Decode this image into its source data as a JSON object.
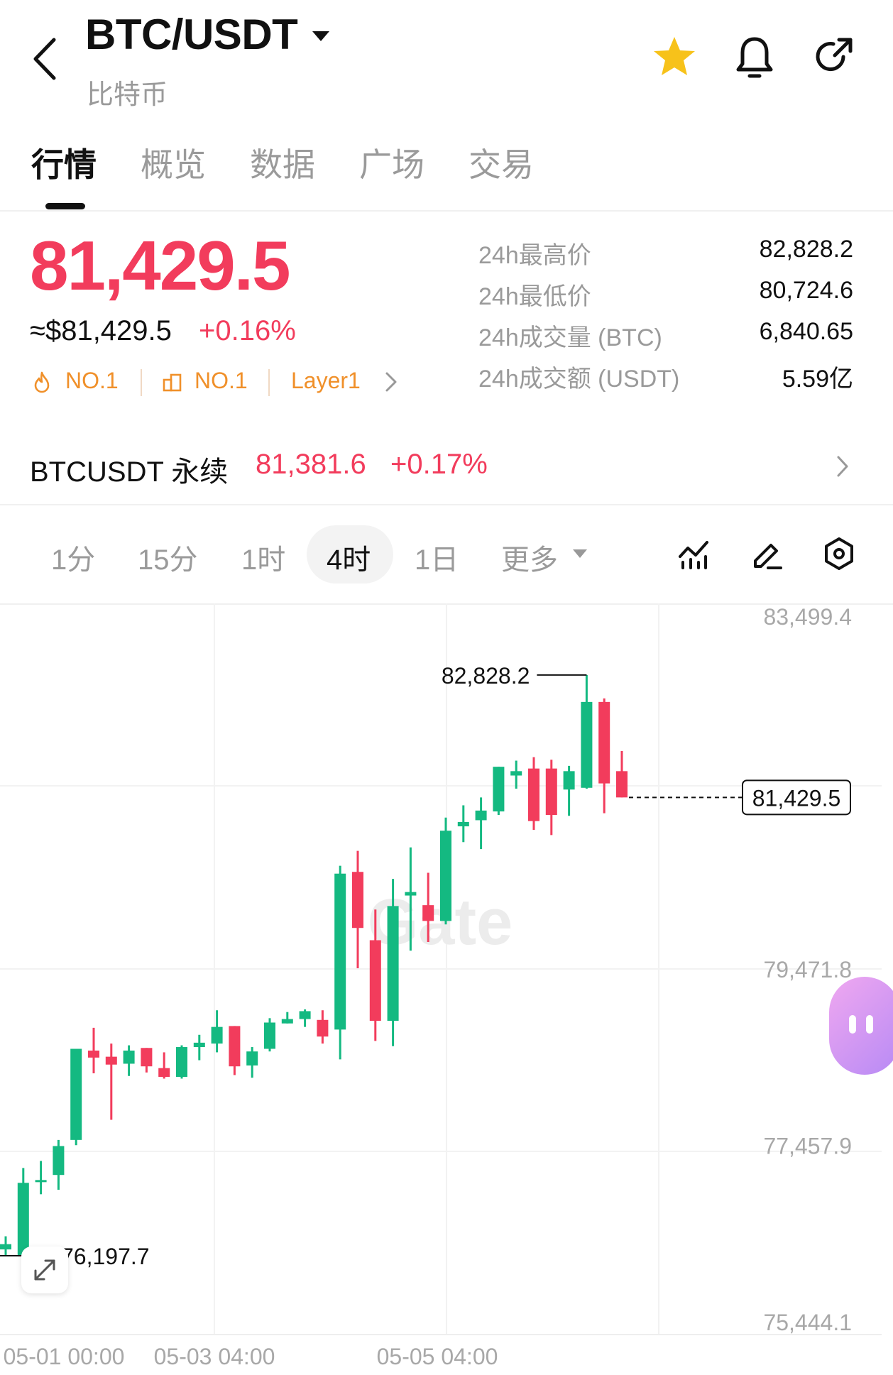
{
  "header": {
    "pair": "BTC/USDT",
    "subtitle": "比特币"
  },
  "tabs": [
    {
      "label": "行情",
      "active": true
    },
    {
      "label": "概览"
    },
    {
      "label": "数据"
    },
    {
      "label": "广场"
    },
    {
      "label": "交易"
    }
  ],
  "quote": {
    "price": "81,429.5",
    "usd_price": "≈$81,429.5",
    "change": "+0.16%",
    "badges": [
      "NO.1",
      "NO.1",
      "Layer1"
    ],
    "stats": [
      {
        "label": "24h最高价",
        "value": "82,828.2"
      },
      {
        "label": "24h最低价",
        "value": "80,724.6"
      },
      {
        "label": "24h成交量 (BTC)",
        "value": "6,840.65"
      },
      {
        "label": "24h成交额 (USDT)",
        "value": "5.59亿"
      }
    ]
  },
  "perpetual": {
    "name": "BTCUSDT 永续",
    "price": "81,381.6",
    "change": "+0.17%"
  },
  "intervals": {
    "items": [
      "1分",
      "15分",
      "1时",
      "4时",
      "1日"
    ],
    "active": "4时",
    "more": "更多"
  },
  "colors": {
    "up": "#f23c5c",
    "down": "#14b981",
    "badge": "#f0902a"
  },
  "chart_data": {
    "type": "candlestick",
    "interval": "4时",
    "ylim": [
      75444.1,
      83499.4
    ],
    "y_ticks": [
      "83,499.4",
      "79,471.8",
      "77,457.9",
      "75,444.1"
    ],
    "x_ticks": [
      "05-01 00:00",
      "05-03 04:00",
      "05-05 04:00"
    ],
    "max_label": "82,828.2",
    "min_label": "76,197.7",
    "last_price_label": "81,429.5",
    "watermark": "Gate",
    "candles": [
      {
        "o": 76270,
        "h": 76420,
        "l": 76200,
        "c": 76330
      },
      {
        "o": 76200,
        "h": 77200,
        "l": 76180,
        "c": 77030
      },
      {
        "o": 77050,
        "h": 77280,
        "l": 76900,
        "c": 77050
      },
      {
        "o": 77120,
        "h": 77520,
        "l": 76950,
        "c": 77450
      },
      {
        "o": 77520,
        "h": 78380,
        "l": 77460,
        "c": 78560
      },
      {
        "o": 78540,
        "h": 78800,
        "l": 78280,
        "c": 78460
      },
      {
        "o": 78470,
        "h": 78620,
        "l": 77750,
        "c": 78380
      },
      {
        "o": 78390,
        "h": 78600,
        "l": 78250,
        "c": 78540
      },
      {
        "o": 78570,
        "h": 78570,
        "l": 78290,
        "c": 78360
      },
      {
        "o": 78340,
        "h": 78520,
        "l": 78220,
        "c": 78240
      },
      {
        "o": 78240,
        "h": 78600,
        "l": 78220,
        "c": 78580
      },
      {
        "o": 78580,
        "h": 78720,
        "l": 78430,
        "c": 78630
      },
      {
        "o": 78620,
        "h": 79000,
        "l": 78520,
        "c": 78810
      },
      {
        "o": 78820,
        "h": 78820,
        "l": 78260,
        "c": 78360
      },
      {
        "o": 78370,
        "h": 78580,
        "l": 78230,
        "c": 78530
      },
      {
        "o": 78560,
        "h": 78910,
        "l": 78530,
        "c": 78860
      },
      {
        "o": 78850,
        "h": 78980,
        "l": 78850,
        "c": 78900
      },
      {
        "o": 78900,
        "h": 79010,
        "l": 78810,
        "c": 78990
      },
      {
        "o": 78890,
        "h": 79000,
        "l": 78620,
        "c": 78700
      },
      {
        "o": 78780,
        "h": 80650,
        "l": 78440,
        "c": 80560
      },
      {
        "o": 80580,
        "h": 80820,
        "l": 79480,
        "c": 79940
      },
      {
        "o": 79800,
        "h": 80150,
        "l": 78650,
        "c": 78880
      },
      {
        "o": 78880,
        "h": 80500,
        "l": 78590,
        "c": 80190
      },
      {
        "o": 80310,
        "h": 80860,
        "l": 79680,
        "c": 80350
      },
      {
        "o": 80200,
        "h": 80570,
        "l": 79780,
        "c": 80020
      },
      {
        "o": 80020,
        "h": 81200,
        "l": 79980,
        "c": 81050
      },
      {
        "o": 81100,
        "h": 81340,
        "l": 80920,
        "c": 81150
      },
      {
        "o": 81170,
        "h": 81430,
        "l": 80840,
        "c": 81280
      },
      {
        "o": 81270,
        "h": 81780,
        "l": 81230,
        "c": 81780
      },
      {
        "o": 81680,
        "h": 81850,
        "l": 81530,
        "c": 81730
      },
      {
        "o": 81760,
        "h": 81890,
        "l": 81060,
        "c": 81160
      },
      {
        "o": 81760,
        "h": 81860,
        "l": 81000,
        "c": 81230
      },
      {
        "o": 81520,
        "h": 81790,
        "l": 81220,
        "c": 81730
      },
      {
        "o": 81540,
        "h": 82828.2,
        "l": 81530,
        "c": 82520
      },
      {
        "o": 82520,
        "h": 82560,
        "l": 81250,
        "c": 81590
      },
      {
        "o": 81730,
        "h": 81960,
        "l": 81430,
        "c": 81430
      }
    ]
  }
}
